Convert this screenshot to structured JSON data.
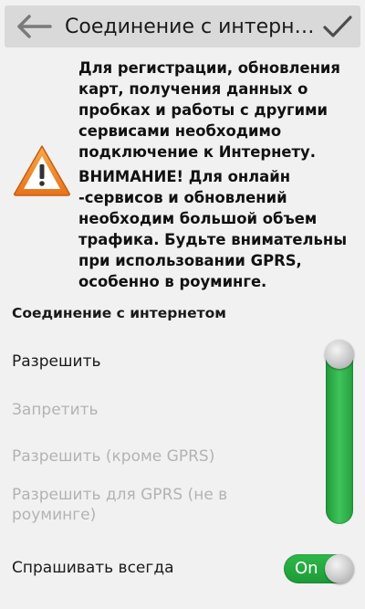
{
  "header": {
    "title": "Соединение с интерне.."
  },
  "warning": {
    "paragraph1": "Для регистрации, обновления карт, получения данных о пробках и работы с другими сервисами необходимо подключение к Интернету.",
    "paragraph2": "ВНИМАНИЕ! Для онлайн -сервисов и обновлений необходим большой объем трафика. Будьте внимательны при использовании GPRS, особенно в роуминге."
  },
  "section": {
    "title": "Соединение с интернетом"
  },
  "options": [
    {
      "label": "Разрешить",
      "enabled": true
    },
    {
      "label": "Запретить",
      "enabled": false
    },
    {
      "label": "Разрешить (кроме GPRS)",
      "enabled": false
    },
    {
      "label": "Разрешить для GPRS (не в роуминге)",
      "enabled": false
    }
  ],
  "slider": {
    "selected_index": 0
  },
  "ask_always": {
    "label": "Спрашивать всегда",
    "toggle_text": "On"
  },
  "colors": {
    "green": "#2fb84b",
    "warning_orange": "#f0892c"
  }
}
